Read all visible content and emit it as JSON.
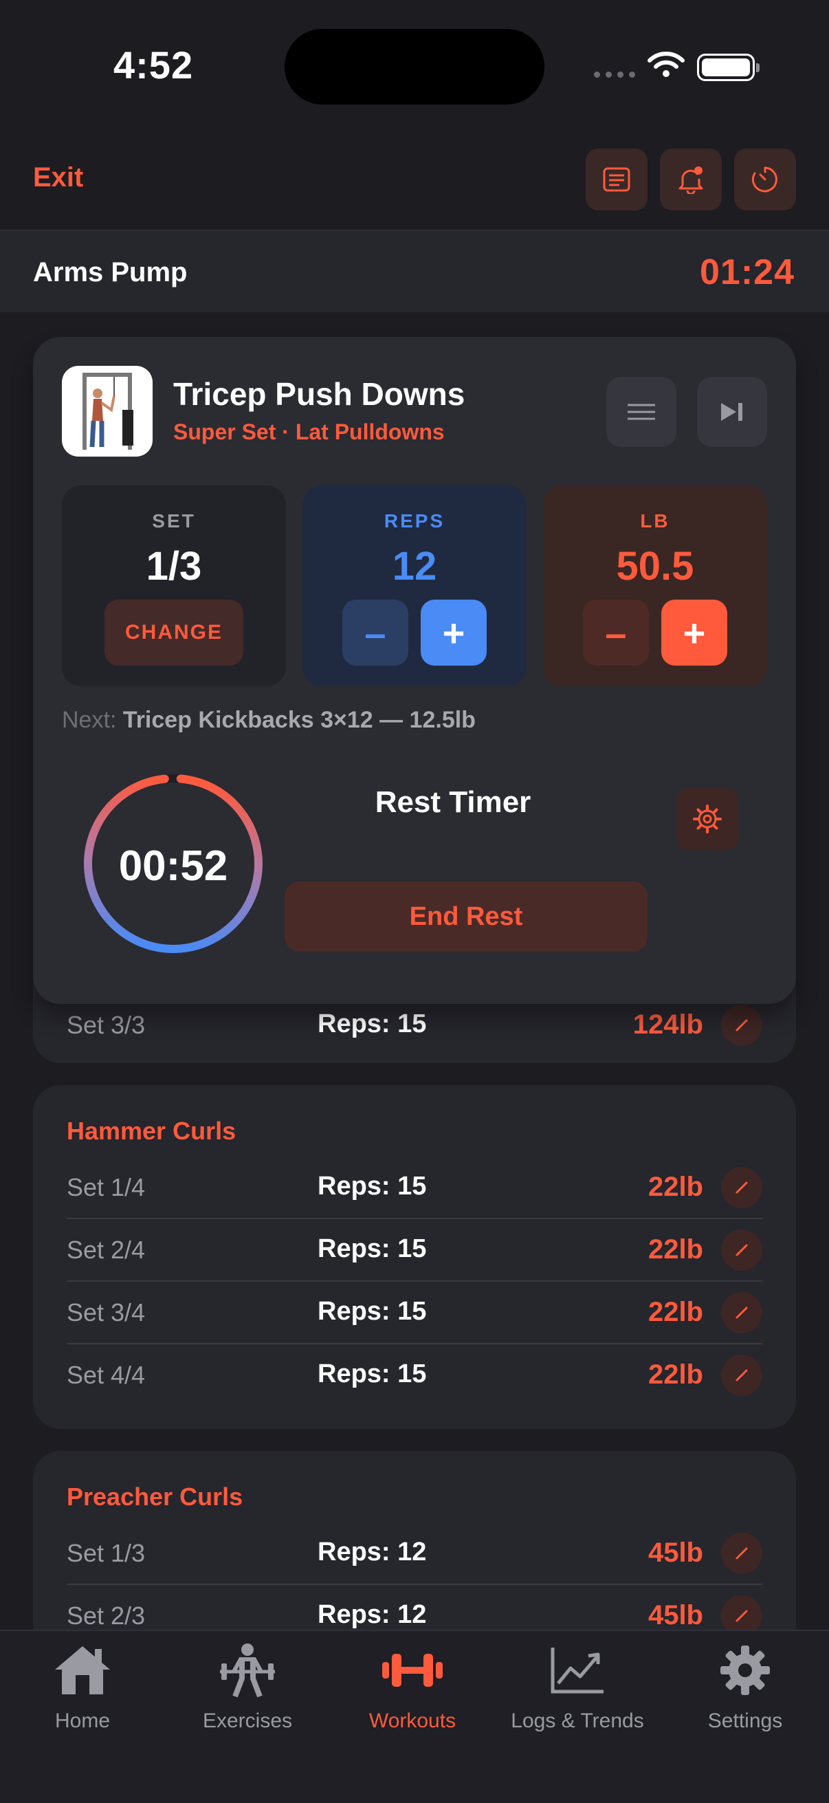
{
  "status_bar": {
    "time": "4:52"
  },
  "top_bar": {
    "exit_label": "Exit"
  },
  "workout": {
    "title": "Arms Pump",
    "elapsed": "01:24"
  },
  "active_exercise": {
    "name": "Tricep Push Downs",
    "subtitle": "Super Set · Lat Pulldowns",
    "set": {
      "label": "SET",
      "value": "1/3",
      "change_label": "CHANGE"
    },
    "reps": {
      "label": "REPS",
      "value": "12",
      "minus": "–",
      "plus": "+"
    },
    "weight": {
      "label": "LB",
      "value": "50.5",
      "minus": "–",
      "plus": "+"
    },
    "next_prefix": "Next:",
    "next_text": "Tricep Kickbacks 3×12 — 12.5lb",
    "rest": {
      "title": "Rest Timer",
      "time": "00:52",
      "end_label": "End Rest",
      "progress": 0.97
    }
  },
  "partial_card": {
    "row": {
      "set": "Set 3/3",
      "reps": "Reps: 15",
      "weight": "124lb"
    }
  },
  "exercise_cards": [
    {
      "title": "Hammer Curls",
      "rows": [
        {
          "set": "Set 1/4",
          "reps": "Reps: 15",
          "weight": "22lb"
        },
        {
          "set": "Set 2/4",
          "reps": "Reps: 15",
          "weight": "22lb"
        },
        {
          "set": "Set 3/4",
          "reps": "Reps: 15",
          "weight": "22lb"
        },
        {
          "set": "Set 4/4",
          "reps": "Reps: 15",
          "weight": "22lb"
        }
      ]
    },
    {
      "title": "Preacher Curls",
      "rows": [
        {
          "set": "Set 1/3",
          "reps": "Reps: 12",
          "weight": "45lb"
        },
        {
          "set": "Set 2/3",
          "reps": "Reps: 12",
          "weight": "45lb"
        }
      ]
    }
  ],
  "nav": {
    "items": [
      {
        "label": "Home",
        "icon": "home-icon"
      },
      {
        "label": "Exercises",
        "icon": "weightlifter-icon"
      },
      {
        "label": "Workouts",
        "icon": "dumbbell-icon",
        "active": true
      },
      {
        "label": "Logs & Trends",
        "icon": "chart-icon"
      },
      {
        "label": "Settings",
        "icon": "gear-icon"
      }
    ]
  },
  "colors": {
    "accent": "#ff5a3c",
    "blue": "#4a8bf5",
    "background": "#1c1c21",
    "card": "#26262d"
  }
}
